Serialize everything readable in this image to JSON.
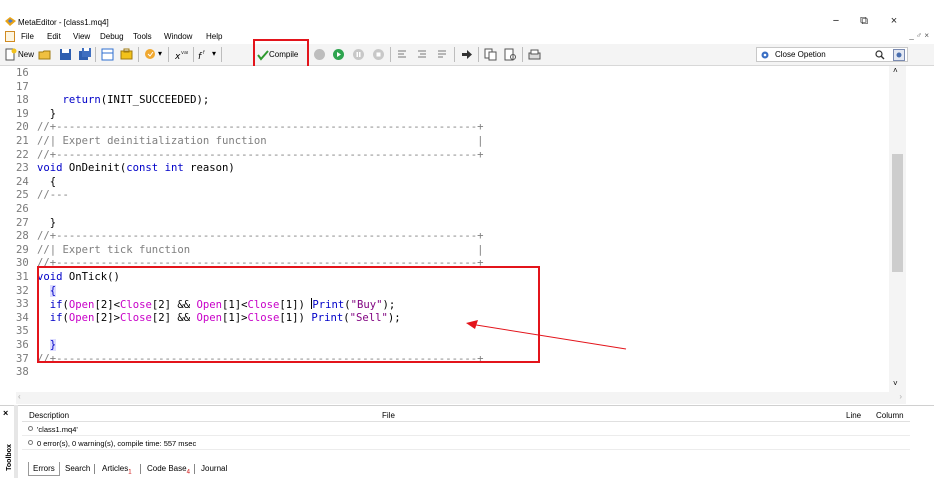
{
  "window": {
    "title": "MetaEditor - [class1.mq4]",
    "controls": {
      "minimize": "−",
      "restore": "⧉",
      "close": "×"
    }
  },
  "menu": {
    "items": [
      "File",
      "Edit",
      "View",
      "Debug",
      "Tools",
      "Window",
      "Help"
    ],
    "mdi_controls": "_ ♂ ×"
  },
  "toolbar": {
    "new_label": "New",
    "compile_label": "Compile",
    "search_value": "Close Opetion"
  },
  "colors": {
    "annotation": "#e3141b",
    "keyword": "#0000c8",
    "comment": "#7f7f7f"
  },
  "editor": {
    "lines": [
      {
        "n": "16",
        "html": ""
      },
      {
        "n": "17",
        "html": ""
      },
      {
        "n": "18",
        "html": "    <span class='kw'>return</span>(INIT_SUCCEEDED);"
      },
      {
        "n": "19",
        "html": "  }"
      },
      {
        "n": "20",
        "html": "<span class='cm'>//+------------------------------------------------------------------+</span>"
      },
      {
        "n": "21",
        "html": "<span class='cm'>//| Expert deinitialization function                                 |</span>"
      },
      {
        "n": "22",
        "html": "<span class='cm'>//+------------------------------------------------------------------+</span>"
      },
      {
        "n": "23",
        "html": "<span class='kw'>void</span> OnDeinit(<span class='kw'>const</span> <span class='kw'>int</span> reason)"
      },
      {
        "n": "24",
        "html": "  {"
      },
      {
        "n": "25",
        "html": "<span class='cm'>//---</span>"
      },
      {
        "n": "26",
        "html": ""
      },
      {
        "n": "27",
        "html": "  }"
      },
      {
        "n": "28",
        "html": "<span class='cm'>//+------------------------------------------------------------------+</span>"
      },
      {
        "n": "29",
        "html": "<span class='cm'>//| Expert tick function                                             |</span>"
      },
      {
        "n": "30",
        "html": "<span class='cm'>//+------------------------------------------------------------------+</span>"
      },
      {
        "n": "31",
        "html": "<span class='kw'>void</span> OnTick()"
      },
      {
        "n": "32",
        "html": "  <span class='br'>{</span>"
      },
      {
        "n": "33",
        "html": "  <span class='kw'>if</span>(<span class='mg'>Open</span>[2]&lt;<span class='mg'>Close</span>[2] &amp;&amp; <span class='mg'>Open</span>[1]&lt;<span class='mg'>Close</span>[1]) <span class='caret'></span><span class='fn'>Print</span>(<span class='st'>\"Buy\"</span>);"
      },
      {
        "n": "34",
        "html": "  <span class='kw'>if</span>(<span class='mg'>Open</span>[2]&gt;<span class='mg'>Close</span>[2] &amp;&amp; <span class='mg'>Open</span>[1]&gt;<span class='mg'>Close</span>[1]) <span class='fn'>Print</span>(<span class='st'>\"Sell\"</span>);"
      },
      {
        "n": "35",
        "html": ""
      },
      {
        "n": "36",
        "html": "  <span class='br'>}</span>"
      },
      {
        "n": "37",
        "html": "<span class='cm'>//+------------------------------------------------------------------+</span>"
      },
      {
        "n": "38",
        "html": ""
      }
    ]
  },
  "toolbox": {
    "label": "Toolbox",
    "columns": {
      "description": "Description",
      "file": "File",
      "line": "Line",
      "column": "Column"
    },
    "rows": [
      "'class1.mq4'",
      "0 error(s), 0 warning(s), compile time: 557 msec"
    ],
    "tabs": [
      "Errors",
      "Search",
      "Articles",
      "Code Base",
      "Journal"
    ],
    "tab_badges": {
      "Articles": "1",
      "Code Base": "4"
    }
  }
}
